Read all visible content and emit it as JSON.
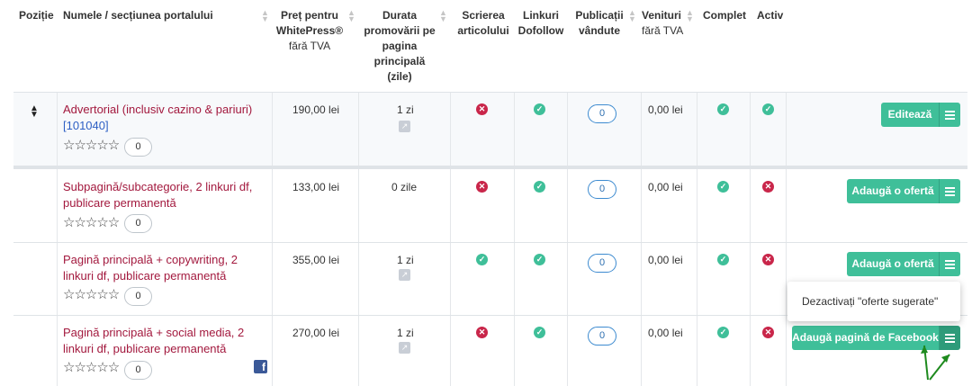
{
  "header": {
    "position": "Poziție",
    "name": "Numele / secțiunea portalului",
    "price_l1": "Preț pentru",
    "price_l2": "WhitePress®",
    "price_sub": "fără TVA",
    "duration_l1": "Durata",
    "duration_l2": "promovării pe",
    "duration_l3": "pagina",
    "duration_l4": "principală",
    "duration_l5": "(zile)",
    "writing_l1": "Scrierea",
    "writing_l2": "articolului",
    "links_l1": "Linkuri",
    "links_l2": "Dofollow",
    "pubs_l1": "Publicații",
    "pubs_l2": "vândute",
    "income": "Venituri",
    "income_sub": "fără TVA",
    "complete": "Complet",
    "active": "Activ"
  },
  "rows": [
    {
      "name": "Advertorial (inclusiv cazino & pariuri)",
      "id": "[101040]",
      "stars": "☆☆☆☆☆",
      "reviews": "0",
      "price": "190,00 lei",
      "duration": "1 zi",
      "writing": "no",
      "dofollow": "ok",
      "sold": "0",
      "income": "0,00 lei",
      "complete": "ok",
      "active": "ok",
      "action": "Editează"
    },
    {
      "name": "Subpagină/subcategorie, 2 linkuri df, publicare permanentă",
      "stars": "☆☆☆☆☆",
      "reviews": "0",
      "price": "133,00 lei",
      "duration": "0 zile",
      "writing": "no",
      "dofollow": "ok",
      "sold": "0",
      "income": "0,00 lei",
      "complete": "ok",
      "active": "no",
      "action": "Adaugă o ofertă"
    },
    {
      "name": "Pagină principală + copywriting, 2 linkuri df, publicare permanentă",
      "stars": "☆☆☆☆☆",
      "reviews": "0",
      "price": "355,00 lei",
      "duration": "1 zi",
      "writing": "ok",
      "dofollow": "ok",
      "sold": "0",
      "income": "0,00 lei",
      "complete": "ok",
      "active": "no",
      "action": "Adaugă o ofertă"
    },
    {
      "name": "Pagină principală + social media, 2 linkuri df, publicare permanentă",
      "stars": "☆☆☆☆☆",
      "reviews": "0",
      "price": "270,00 lei",
      "duration": "1 zi",
      "writing": "no",
      "dofollow": "ok",
      "sold": "0",
      "income": "0,00 lei",
      "complete": "ok",
      "active": "no",
      "action": "Adaugă pagină de Facebook"
    }
  ],
  "popup": {
    "label": "Dezactivați \"oferte sugerate\""
  },
  "colors": {
    "accent": "#3fbf99",
    "danger": "#c9264a",
    "link": "#a3193e",
    "arrow": "#1e8a1e"
  }
}
